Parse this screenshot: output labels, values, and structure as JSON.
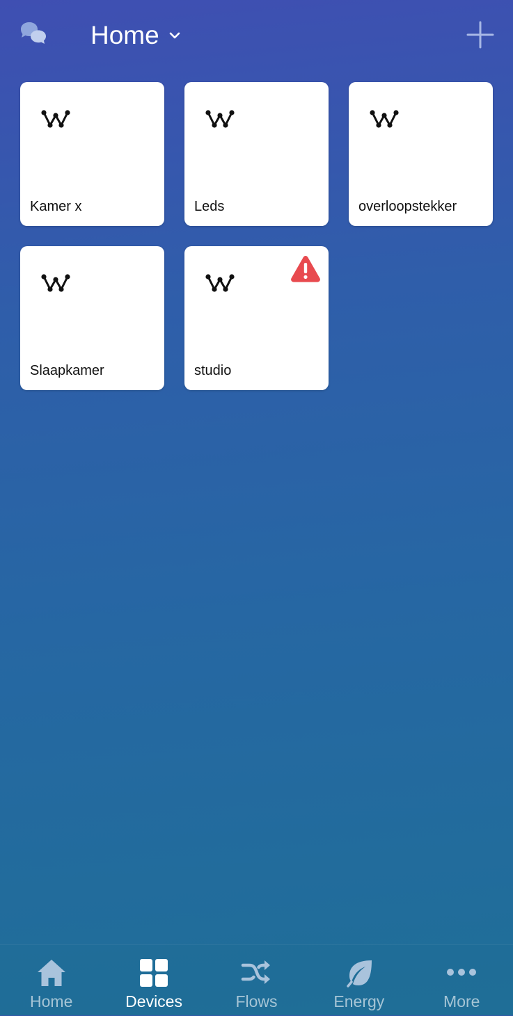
{
  "header": {
    "title": "Home"
  },
  "devices": [
    {
      "name": "Kamer x",
      "icon": "homey-device-icon",
      "warning": false
    },
    {
      "name": "Leds",
      "icon": "homey-device-icon",
      "warning": false
    },
    {
      "name": "overloopstekker",
      "icon": "homey-device-icon",
      "warning": false
    },
    {
      "name": "Slaapkamer",
      "icon": "homey-device-icon",
      "warning": false
    },
    {
      "name": "studio",
      "icon": "homey-device-icon",
      "warning": true
    }
  ],
  "nav": {
    "items": [
      {
        "label": "Home",
        "icon": "house-icon",
        "active": false
      },
      {
        "label": "Devices",
        "icon": "grid-icon",
        "active": true
      },
      {
        "label": "Flows",
        "icon": "shuffle-icon",
        "active": false
      },
      {
        "label": "Energy",
        "icon": "leaf-icon",
        "active": false
      },
      {
        "label": "More",
        "icon": "more-dots-icon",
        "active": false
      }
    ]
  },
  "colors": {
    "background_top": "#3f4fb2",
    "background_bottom": "#1f6f98",
    "tile": "#ffffff",
    "warning": "#e84a4f",
    "nav_inactive": "#a9c3dc",
    "nav_active": "#ffffff"
  }
}
